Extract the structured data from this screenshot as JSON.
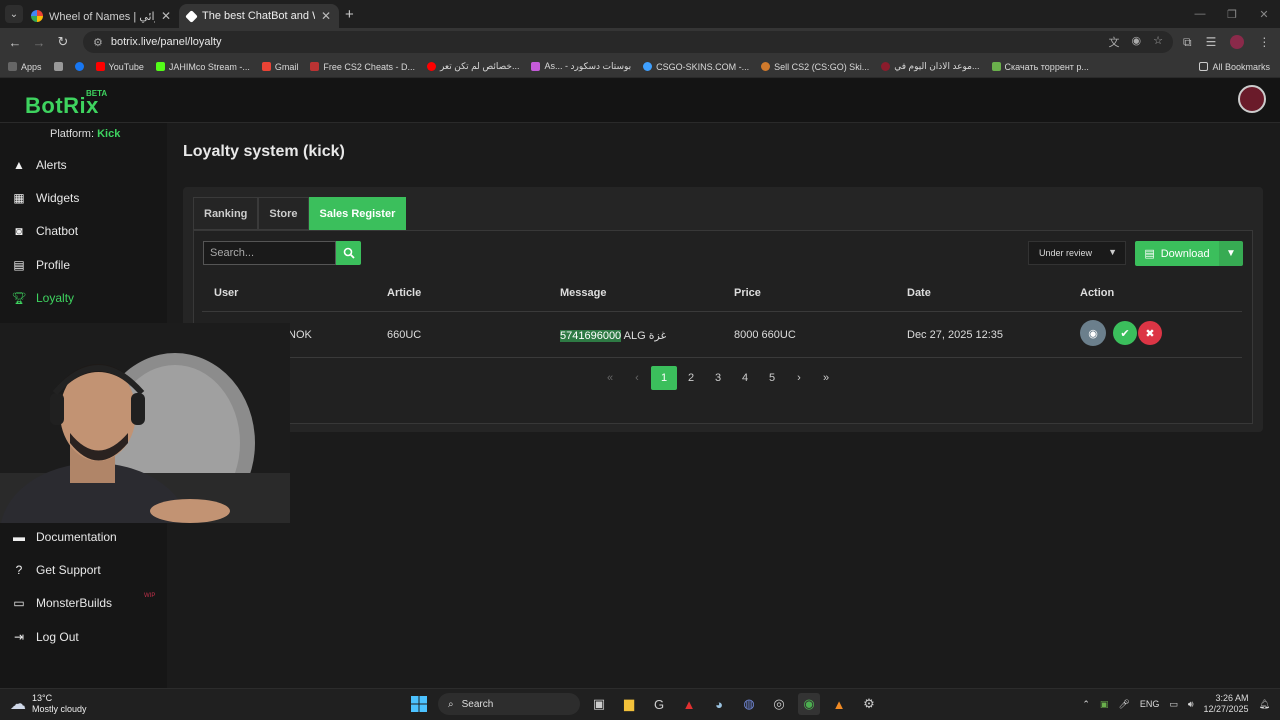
{
  "browser": {
    "tabs": [
      {
        "title": "Wheel of Names | اسم العشوائي",
        "favicon_color": "#4285f4"
      },
      {
        "title": "The best ChatBot and Widgets",
        "favicon_color": "#ffffff"
      }
    ],
    "url": "botrix.live/panel/loyalty",
    "bookmarks": [
      {
        "label": "Apps",
        "color": "#4285f4"
      },
      {
        "label": "YouTube",
        "color": "#ff0000"
      },
      {
        "label": "JAHIMco Stream -...",
        "color": "#53fc18"
      },
      {
        "label": "Gmail",
        "color": "#ea4335"
      },
      {
        "label": "Free CS2 Cheats - D...",
        "color": "#b33"
      },
      {
        "label": "خصائص لم تكن تعر...",
        "color": "#ff0000"
      },
      {
        "label": "As... - بوستات دسكورد",
        "color": "#c45bd8"
      },
      {
        "label": "CSGO-SKINS.COM -...",
        "color": "#3fa0ff"
      },
      {
        "label": "Sell CS2 (CS:GO) Ski...",
        "color": "#d07a2c"
      },
      {
        "label": "موعد الاذان اليوم في...",
        "color": "#8b1c2c"
      },
      {
        "label": "Скачать торрент р...",
        "color": "#6ab04c"
      }
    ],
    "all_bookmarks": "All Bookmarks"
  },
  "app": {
    "logo": "BotRix",
    "beta": "BETA",
    "platform_label": "Platform:",
    "platform_value": "Kick",
    "nav": [
      {
        "label": "Alerts",
        "icon": "warning-icon"
      },
      {
        "label": "Widgets",
        "icon": "grid-icon"
      },
      {
        "label": "Chatbot",
        "icon": "robot-icon"
      },
      {
        "label": "Profile",
        "icon": "id-card-icon"
      },
      {
        "label": "Loyalty",
        "icon": "trophy-icon"
      }
    ],
    "nav_bottom": [
      {
        "label": "Documentation",
        "icon": "book-icon"
      },
      {
        "label": "Get Support",
        "icon": "question-icon"
      },
      {
        "label": "MonsterBuilds",
        "icon": "laptop-icon"
      },
      {
        "label": "Log Out",
        "icon": "logout-icon"
      }
    ],
    "wip_badge": "WIP",
    "accent_color": "#3bbf5c"
  },
  "page": {
    "title": "Loyalty system (kick)",
    "tabs": [
      {
        "label": "Ranking",
        "active": false
      },
      {
        "label": "Store",
        "active": false
      },
      {
        "label": "Sales Register",
        "active": true
      }
    ],
    "search_placeholder": "Search...",
    "filter_value": "Under review",
    "download_label": "Download",
    "columns": [
      "User",
      "Article",
      "Message",
      "Price",
      "Date",
      "Action"
    ],
    "rows": [
      {
        "user": "NOK",
        "article": "660UC",
        "message_highlight": "5741696000",
        "message_rest": " ALG غزة",
        "price": "8000 660UC",
        "date": "Dec 27, 2025 12:35"
      }
    ],
    "pagination": {
      "pages": [
        "1",
        "2",
        "3",
        "4",
        "5"
      ],
      "current": "1"
    }
  },
  "taskbar": {
    "temperature": "13°C",
    "weather": "Mostly cloudy",
    "search_label": "Search",
    "language": "ENG",
    "time": "3:26 AM",
    "date": "12/27/2025"
  }
}
